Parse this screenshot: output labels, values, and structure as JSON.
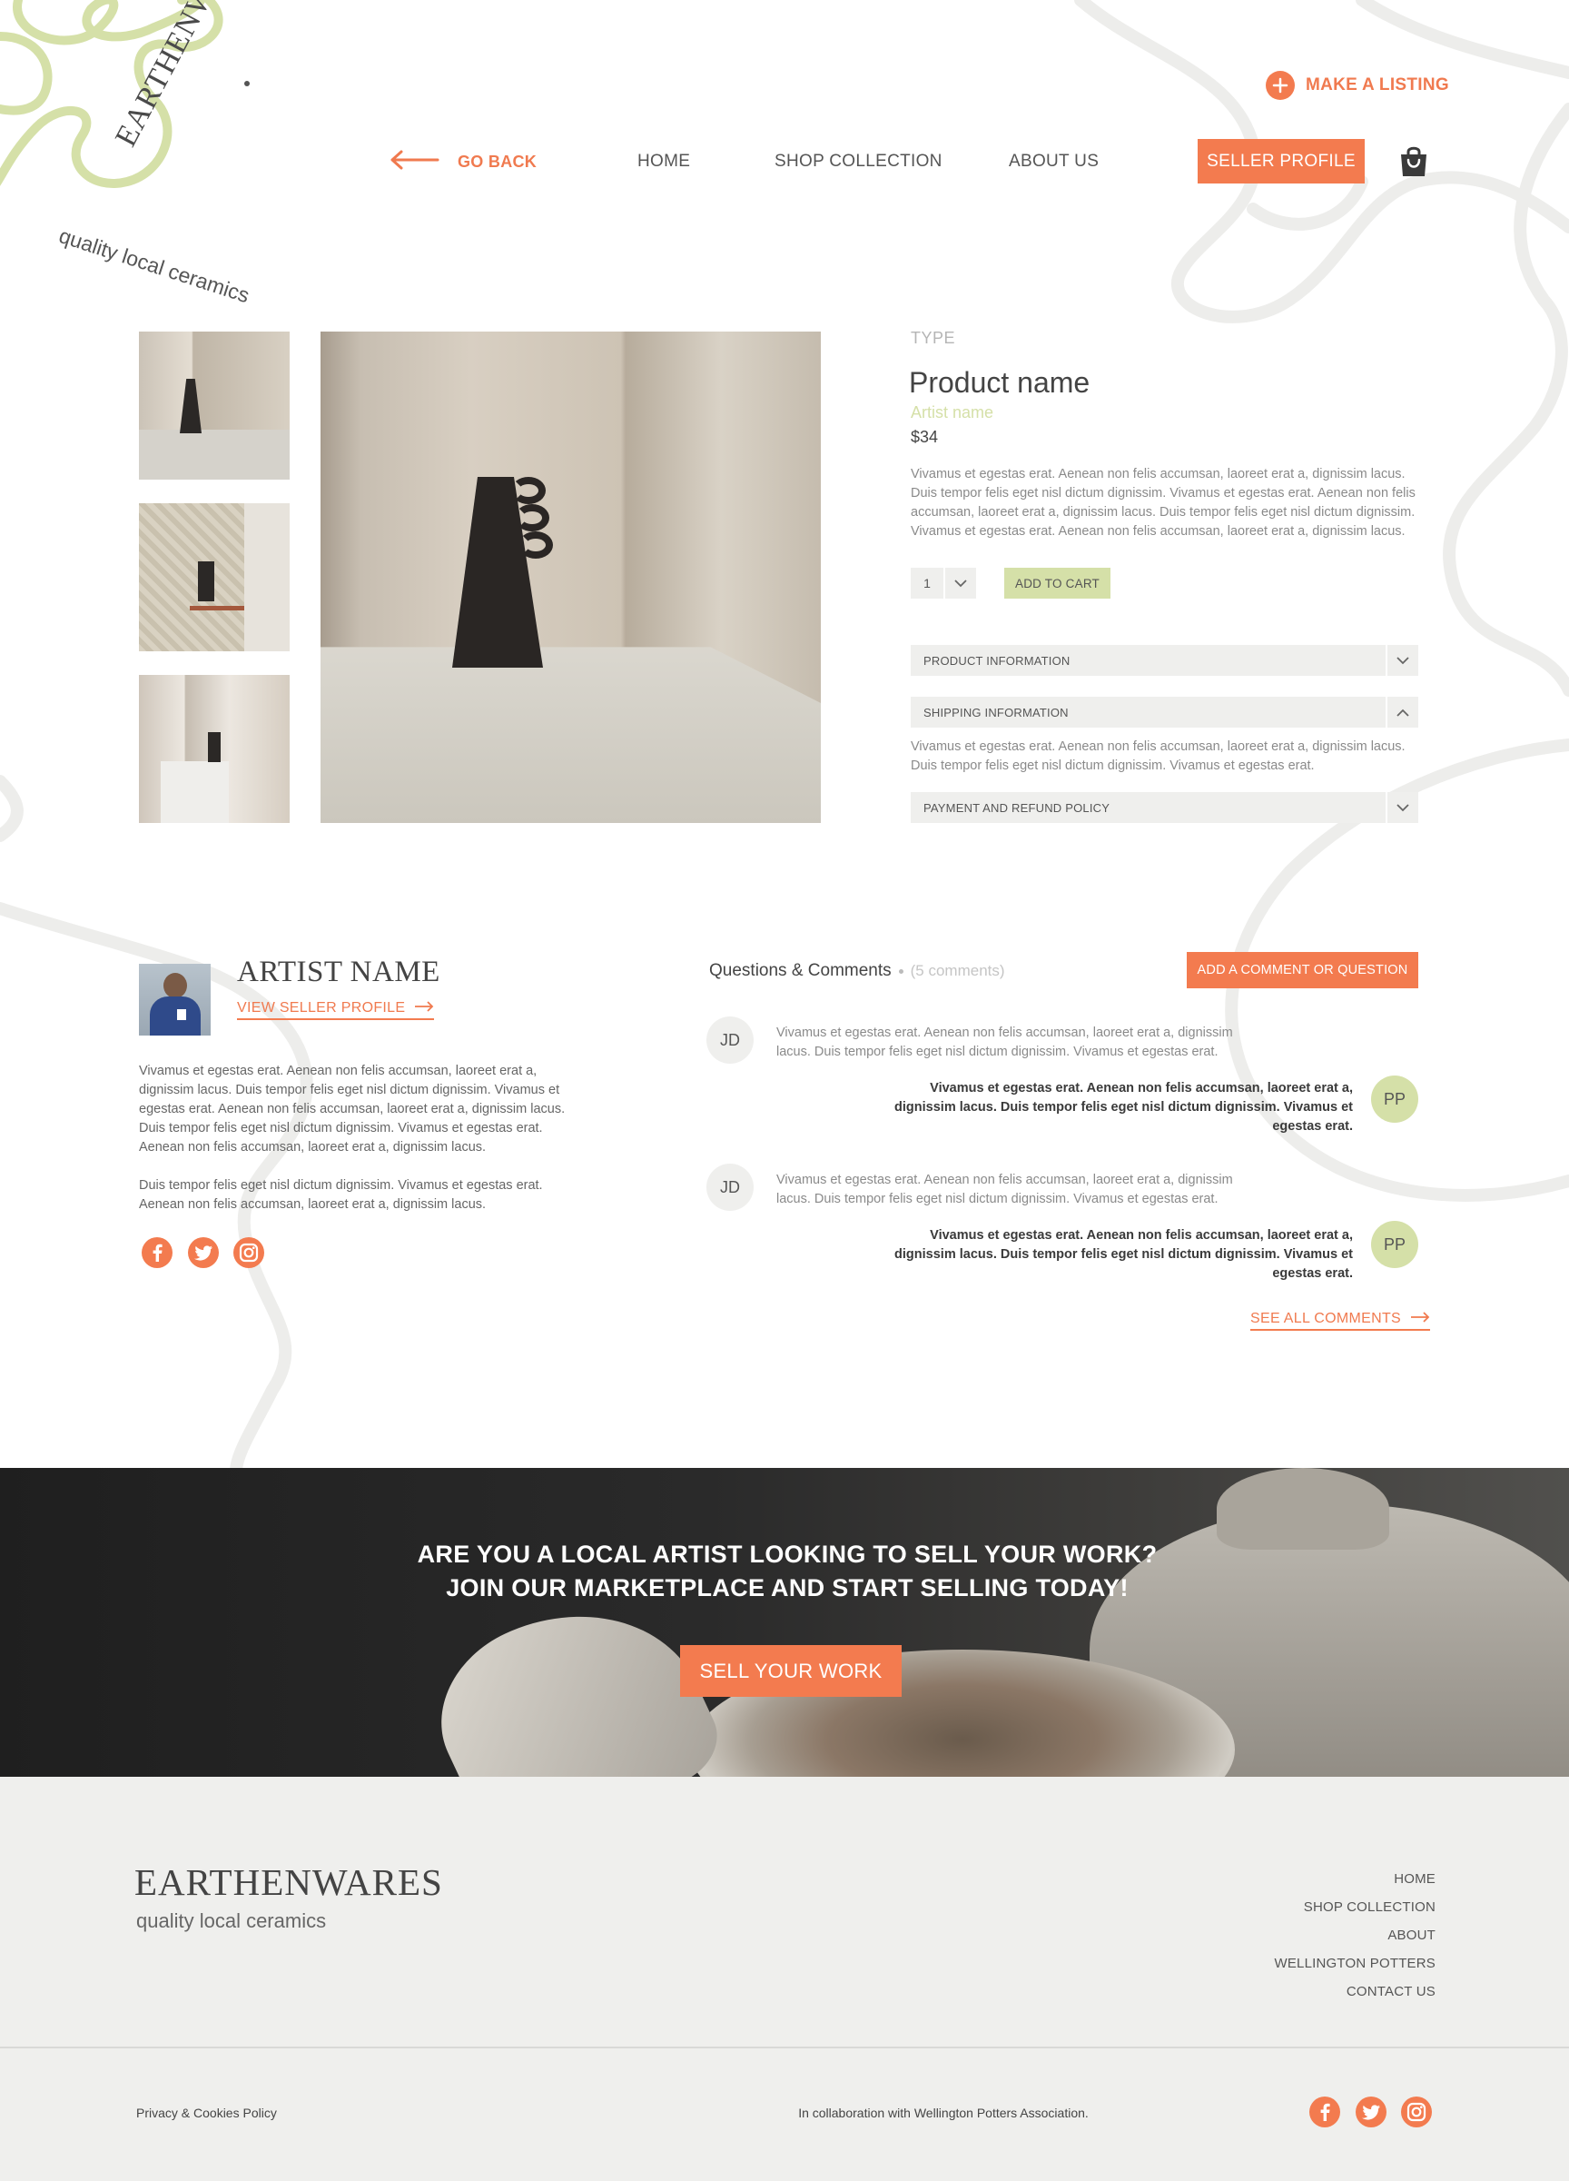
{
  "brand": {
    "name": "EARTHENWARES",
    "tagline": "quality local ceramics",
    "accent": "#f37b4f",
    "green": "#d5e0a8"
  },
  "header": {
    "make_listing": "MAKE A LISTING",
    "go_back": "GO BACK",
    "nav": [
      "HOME",
      "SHOP COLLECTION",
      "ABOUT US"
    ],
    "seller_profile": "SELLER PROFILE"
  },
  "product": {
    "type": "TYPE",
    "name": "Product name",
    "artist": "Artist name",
    "price": "$34",
    "description": "Vivamus et egestas erat. Aenean non felis accumsan, laoreet erat a, dignissim lacus. Duis tempor felis eget nisl dictum dignissim. Vivamus et egestas erat. Aenean non felis accumsan, laoreet erat a, dignissim lacus. Duis tempor felis eget nisl dictum dignissim. Vivamus et egestas erat. Aenean non felis accumsan, laoreet erat a, dignissim lacus.",
    "quantity": "1",
    "add_to_cart": "ADD TO CART",
    "accordions": {
      "product_info": "PRODUCT INFORMATION",
      "shipping_info": "SHIPPING INFORMATION",
      "shipping_text": "Vivamus et egestas erat. Aenean non felis accumsan, laoreet erat a, dignissim lacus. Duis tempor felis eget nisl dictum dignissim. Vivamus et egestas erat.",
      "payment": "PAYMENT AND REFUND POLICY"
    }
  },
  "artist": {
    "name": "ARTIST NAME",
    "view_profile": "VIEW SELLER PROFILE",
    "bio1": "Vivamus et egestas erat. Aenean non felis accumsan, laoreet erat a, dignissim lacus. Duis tempor felis eget nisl dictum dignissim. Vivamus et egestas erat. Aenean non felis accumsan, laoreet erat a, dignissim lacus. Duis tempor felis eget nisl dictum dignissim. Vivamus et egestas erat. Aenean non felis accumsan, laoreet erat a, dignissim lacus.",
    "bio2": "Duis tempor felis eget nisl dictum dignissim. Vivamus et egestas erat. Aenean non felis accumsan, laoreet erat a, dignissim lacus."
  },
  "comments": {
    "title": "Questions & Comments",
    "count": "(5 comments)",
    "add_button": "ADD A COMMENT OR QUESTION",
    "threads": [
      {
        "q_initials": "JD",
        "q_text": "Vivamus et egestas erat. Aenean non felis accumsan, laoreet erat a, dignissim lacus. Duis tempor felis eget nisl dictum dignissim. Vivamus et egestas erat.",
        "a_initials": "PP",
        "a_text": "Vivamus et egestas erat. Aenean non felis accumsan, laoreet erat a, dignissim lacus. Duis tempor felis eget nisl dictum dignissim. Vivamus et egestas erat."
      },
      {
        "q_initials": "JD",
        "q_text": "Vivamus et egestas erat. Aenean non felis accumsan, laoreet erat a, dignissim lacus. Duis tempor felis eget nisl dictum dignissim. Vivamus et egestas erat.",
        "a_initials": "PP",
        "a_text": "Vivamus et egestas erat. Aenean non felis accumsan, laoreet erat a, dignissim lacus. Duis tempor felis eget nisl dictum dignissim. Vivamus et egestas erat."
      }
    ],
    "see_all": "SEE ALL COMMENTS"
  },
  "banner": {
    "line1": "ARE YOU A LOCAL ARTIST LOOKING TO SELL YOUR WORK?",
    "line2": "JOIN OUR MARKETPLACE AND START SELLING TODAY!",
    "button": "SELL YOUR WORK"
  },
  "footer": {
    "links": [
      "HOME",
      "SHOP COLLECTION",
      "ABOUT",
      "WELLINGTON POTTERS",
      "CONTACT US"
    ],
    "privacy": "Privacy & Cookies Policy",
    "collab": "In collaboration with Wellington Potters Association."
  }
}
